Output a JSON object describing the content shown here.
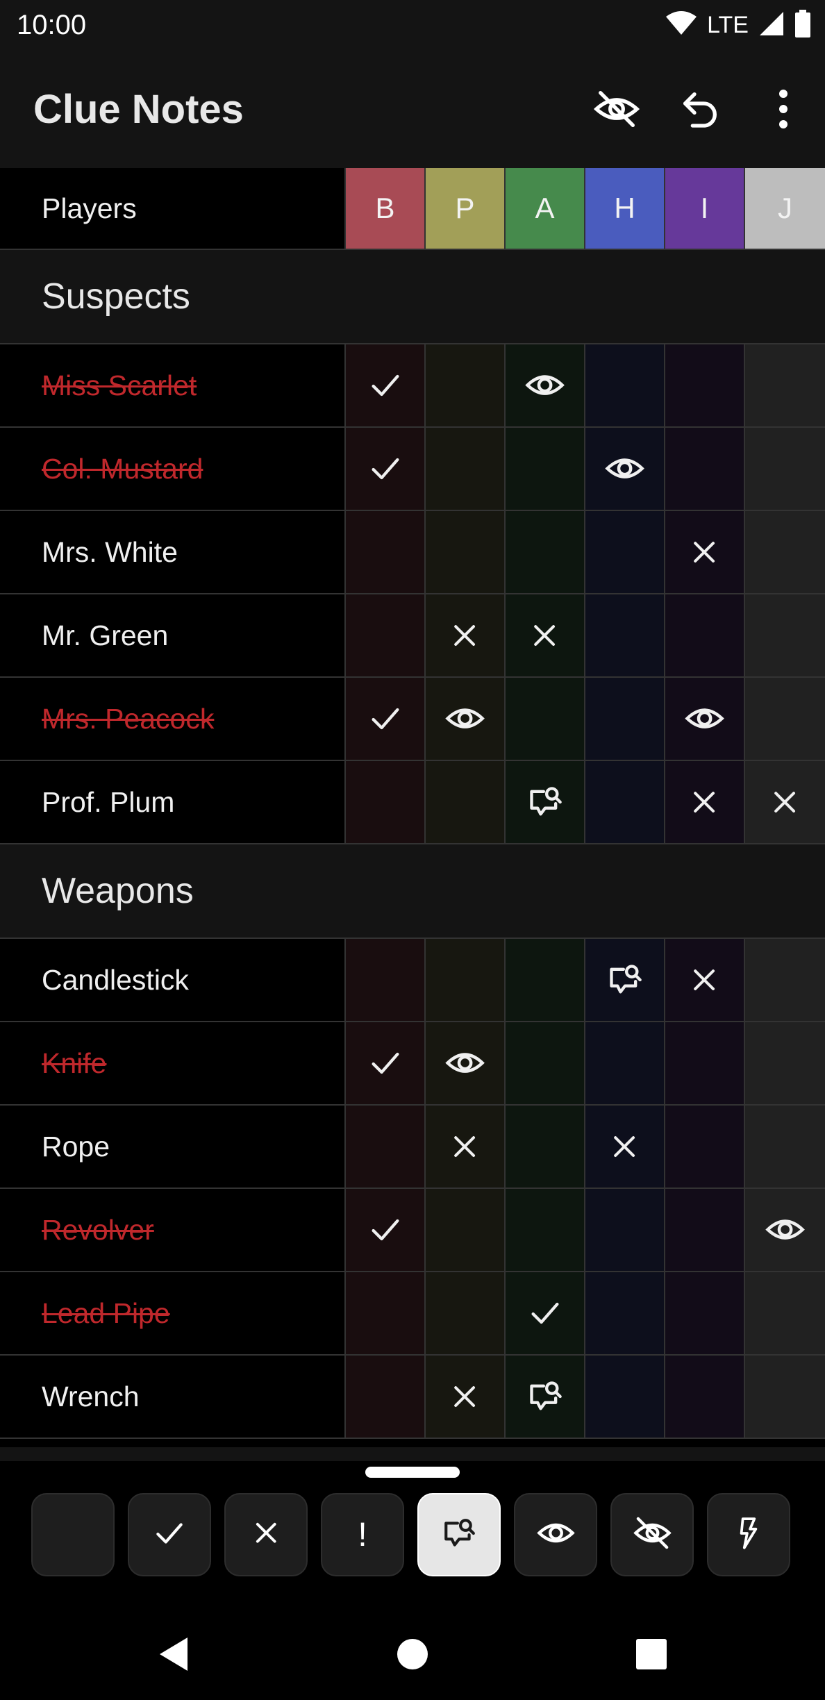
{
  "status_bar": {
    "time": "10:00",
    "network": "LTE"
  },
  "app_bar": {
    "title": "Clue Notes",
    "icons": [
      "visibility-off-icon",
      "undo-icon",
      "more-vert-icon"
    ]
  },
  "players_row": {
    "label": "Players",
    "players": [
      {
        "initial": "B",
        "color": "#a84b55"
      },
      {
        "initial": "P",
        "color": "#a29f58"
      },
      {
        "initial": "A",
        "color": "#468a4c"
      },
      {
        "initial": "H",
        "color": "#4a5cbe"
      },
      {
        "initial": "I",
        "color": "#66399a"
      },
      {
        "initial": "J",
        "color": "#bdbdbd"
      }
    ]
  },
  "sections": [
    {
      "title": "Suspects",
      "rows": [
        {
          "name": "Miss Scarlet",
          "struck": true,
          "marks": [
            "check",
            "",
            "eye",
            "",
            "",
            ""
          ]
        },
        {
          "name": "Col. Mustard",
          "struck": true,
          "marks": [
            "check",
            "",
            "",
            "eye",
            "",
            ""
          ]
        },
        {
          "name": "Mrs. White",
          "struck": false,
          "marks": [
            "",
            "",
            "",
            "",
            "cross",
            ""
          ]
        },
        {
          "name": "Mr. Green",
          "struck": false,
          "marks": [
            "",
            "cross",
            "cross",
            "",
            "",
            ""
          ]
        },
        {
          "name": "Mrs. Peacock",
          "struck": true,
          "marks": [
            "check",
            "eye",
            "",
            "",
            "eye",
            ""
          ]
        },
        {
          "name": "Prof. Plum",
          "struck": false,
          "marks": [
            "",
            "",
            "suggest",
            "",
            "cross",
            "cross"
          ]
        }
      ]
    },
    {
      "title": "Weapons",
      "rows": [
        {
          "name": "Candlestick",
          "struck": false,
          "marks": [
            "",
            "",
            "",
            "suggest",
            "cross",
            ""
          ]
        },
        {
          "name": "Knife",
          "struck": true,
          "marks": [
            "check",
            "eye",
            "",
            "",
            "",
            ""
          ]
        },
        {
          "name": "Rope",
          "struck": false,
          "marks": [
            "",
            "cross",
            "",
            "cross",
            "",
            ""
          ]
        },
        {
          "name": "Revolver",
          "struck": true,
          "marks": [
            "check",
            "",
            "",
            "",
            "",
            "eye"
          ]
        },
        {
          "name": "Lead Pipe",
          "struck": true,
          "marks": [
            "",
            "",
            "check",
            "",
            "",
            ""
          ]
        },
        {
          "name": "Wrench",
          "struck": false,
          "marks": [
            "",
            "cross",
            "suggest",
            "",
            "",
            ""
          ]
        }
      ]
    }
  ],
  "toolbar": {
    "tools": [
      "blank",
      "check",
      "cross",
      "bang",
      "suggest",
      "eye",
      "eye-off",
      "bolt"
    ],
    "bang_label": "!",
    "selected": "suggest"
  },
  "nav": [
    "back-icon",
    "home-icon",
    "recents-icon"
  ],
  "colors": {
    "struck_text": "#c0282c",
    "background": "#000000",
    "header": "#141414"
  }
}
